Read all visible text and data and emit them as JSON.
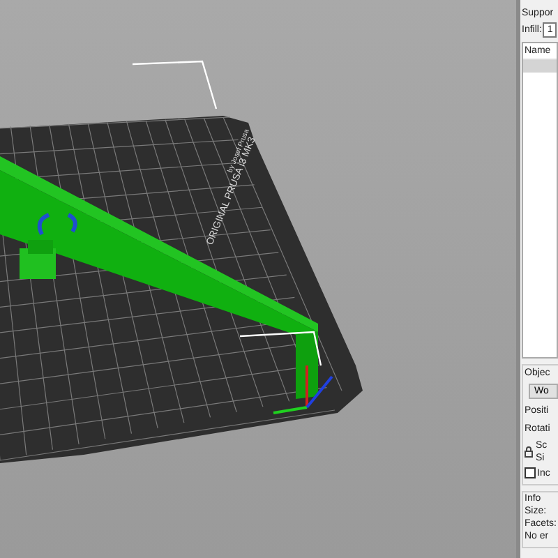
{
  "viewport": {
    "bed_label": "ORIGINAL PRUSA i3 MK3",
    "bed_sublabel": "by Josef Prusa"
  },
  "sidebar": {
    "supports_label": "Suppor",
    "infill_label": "Infill:",
    "infill_value": "1",
    "objects_list": {
      "column": "Name",
      "rows": [
        {
          "name": "",
          "selected": true
        }
      ]
    },
    "object_manipulation": {
      "title": "Objec",
      "coordinates_button": "Wo",
      "position_label": "Positi",
      "rotation_label": "Rotati",
      "scale_label": "Sc",
      "size_label": "Si",
      "inches": {
        "label": "Inc",
        "checked": false
      }
    },
    "info": {
      "title": "Info",
      "size_label": "Size:",
      "facets_label": "Facets:",
      "errors_label": "No er"
    }
  }
}
